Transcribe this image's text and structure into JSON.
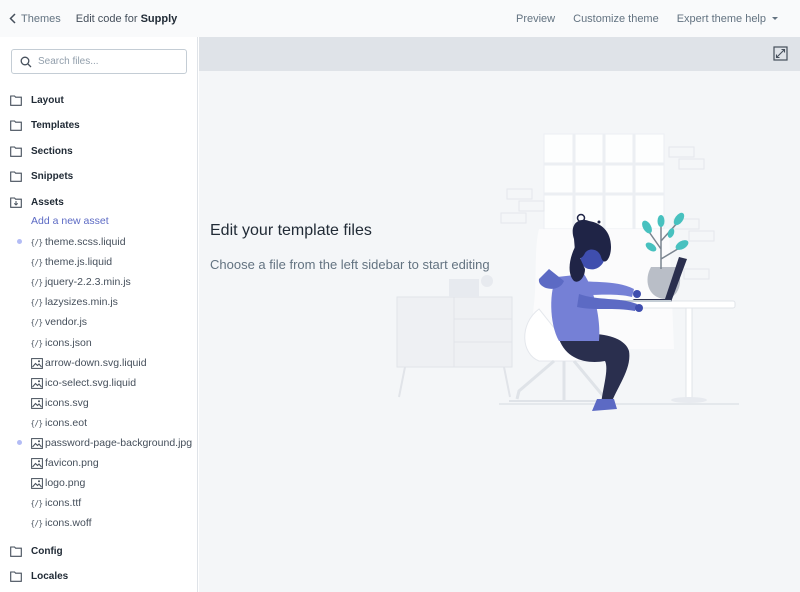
{
  "topbar": {
    "back_label": "Themes",
    "title_prefix": "Edit code for",
    "theme_name": "Supply",
    "links": {
      "preview": "Preview",
      "customize": "Customize theme",
      "help": "Expert theme help"
    }
  },
  "sidebar": {
    "search_placeholder": "Search files...",
    "folders": {
      "layout": "Layout",
      "templates": "Templates",
      "sections": "Sections",
      "snippets": "Snippets",
      "assets": "Assets",
      "config": "Config",
      "locales": "Locales"
    },
    "add_asset": "Add a new asset",
    "assets": [
      {
        "icon": "code",
        "code_glyph": "{/}",
        "name": "theme.scss.liquid",
        "modified": true
      },
      {
        "icon": "code",
        "code_glyph": "{/}",
        "name": "theme.js.liquid",
        "modified": false
      },
      {
        "icon": "code",
        "code_glyph": "{/}",
        "name": "jquery-2.2.3.min.js",
        "modified": false
      },
      {
        "icon": "code",
        "code_glyph": "{/}",
        "name": "lazysizes.min.js",
        "modified": false
      },
      {
        "icon": "code",
        "code_glyph": "{/}",
        "name": "vendor.js",
        "modified": false
      },
      {
        "icon": "code",
        "code_glyph": "{/}",
        "name": "icons.json",
        "modified": false
      },
      {
        "icon": "image",
        "name": "arrow-down.svg.liquid",
        "modified": false
      },
      {
        "icon": "image",
        "name": "ico-select.svg.liquid",
        "modified": false
      },
      {
        "icon": "image",
        "name": "icons.svg",
        "modified": false
      },
      {
        "icon": "code",
        "code_glyph": "{/}",
        "name": "icons.eot",
        "modified": false
      },
      {
        "icon": "image",
        "name": "password-page-background.jpg",
        "modified": true
      },
      {
        "icon": "image",
        "name": "favicon.png",
        "modified": false
      },
      {
        "icon": "image",
        "name": "logo.png",
        "modified": false
      },
      {
        "icon": "code",
        "code_glyph": "{/}",
        "name": "icons.ttf",
        "modified": false
      },
      {
        "icon": "code",
        "code_glyph": "{/}",
        "name": "icons.woff",
        "modified": false
      }
    ]
  },
  "main": {
    "empty_title": "Edit your template files",
    "empty_subtitle": "Choose a file from the left sidebar to start editing"
  },
  "colors": {
    "accent": "#5c6ac4",
    "modified_dot": "#b3bcf5",
    "header_bg": "#dfe3e8",
    "canvas_bg": "#f4f6f8"
  }
}
